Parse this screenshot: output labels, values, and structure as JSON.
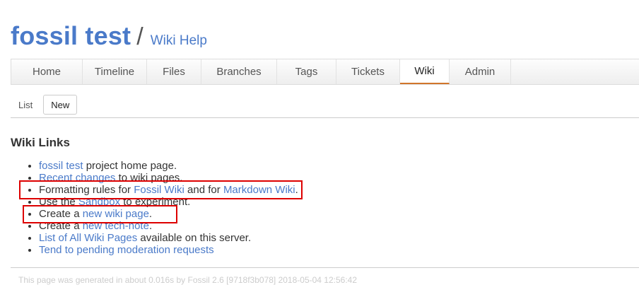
{
  "header": {
    "project_title": "fossil test",
    "separator": "/",
    "page_title": "Wiki Help"
  },
  "mainmenu": {
    "items": [
      {
        "label": "Home"
      },
      {
        "label": "Timeline"
      },
      {
        "label": "Files"
      },
      {
        "label": "Branches"
      },
      {
        "label": "Tags"
      },
      {
        "label": "Tickets"
      },
      {
        "label": "Wiki"
      },
      {
        "label": "Admin"
      }
    ],
    "active": "Wiki"
  },
  "submenu": {
    "list_label": "List",
    "new_label": "New"
  },
  "content": {
    "heading": "Wiki Links",
    "items": [
      {
        "link1": "fossil test",
        "text1": " project home page."
      },
      {
        "link1": "Recent changes",
        "text1": " to wiki pages."
      },
      {
        "text0": "Formatting rules for ",
        "link1": "Fossil Wiki",
        "text1": " and for ",
        "link2": "Markdown Wiki",
        "text2": "."
      },
      {
        "text0": "Use the ",
        "link1": "Sandbox",
        "text1": " to experiment."
      },
      {
        "text0": "Create a ",
        "link1": "new wiki page",
        "text1": "."
      },
      {
        "text0": "Create a ",
        "link1": "new tech-note",
        "text1": "."
      },
      {
        "link1": "List of All Wiki Pages",
        "text1": " available on this server."
      },
      {
        "link1": "Tend to pending moderation requests"
      }
    ]
  },
  "footer": {
    "text": "This page was generated in about 0.016s by Fossil 2.6 [9718f3b078] 2018-05-04 12:56:42"
  },
  "colors": {
    "link": "#4a7ac9",
    "highlight": "#dd0000",
    "active_tab_underline": "#d1762b"
  }
}
